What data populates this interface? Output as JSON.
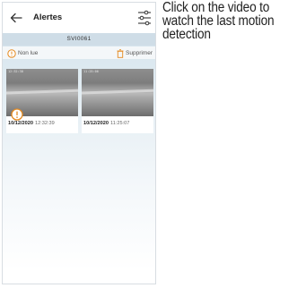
{
  "header": {
    "title": "Alertes",
    "back_icon": "arrow-left-icon",
    "filter_icon": "sliders-icon"
  },
  "device": {
    "name": "SVI0061"
  },
  "actions": {
    "unread_label": "Non lue",
    "delete_label": "Supprimer",
    "accent_color": "#e58a1f"
  },
  "alerts": [
    {
      "timestamp_overlay": "12:32:38",
      "date": "10/12/2020",
      "time": "12:32:39",
      "unread": true
    },
    {
      "timestamp_overlay": "11:25:06",
      "date": "10/12/2020",
      "time": "11:25:07",
      "unread": false
    }
  ],
  "caption": "Click on the video to watch the last motion detection"
}
